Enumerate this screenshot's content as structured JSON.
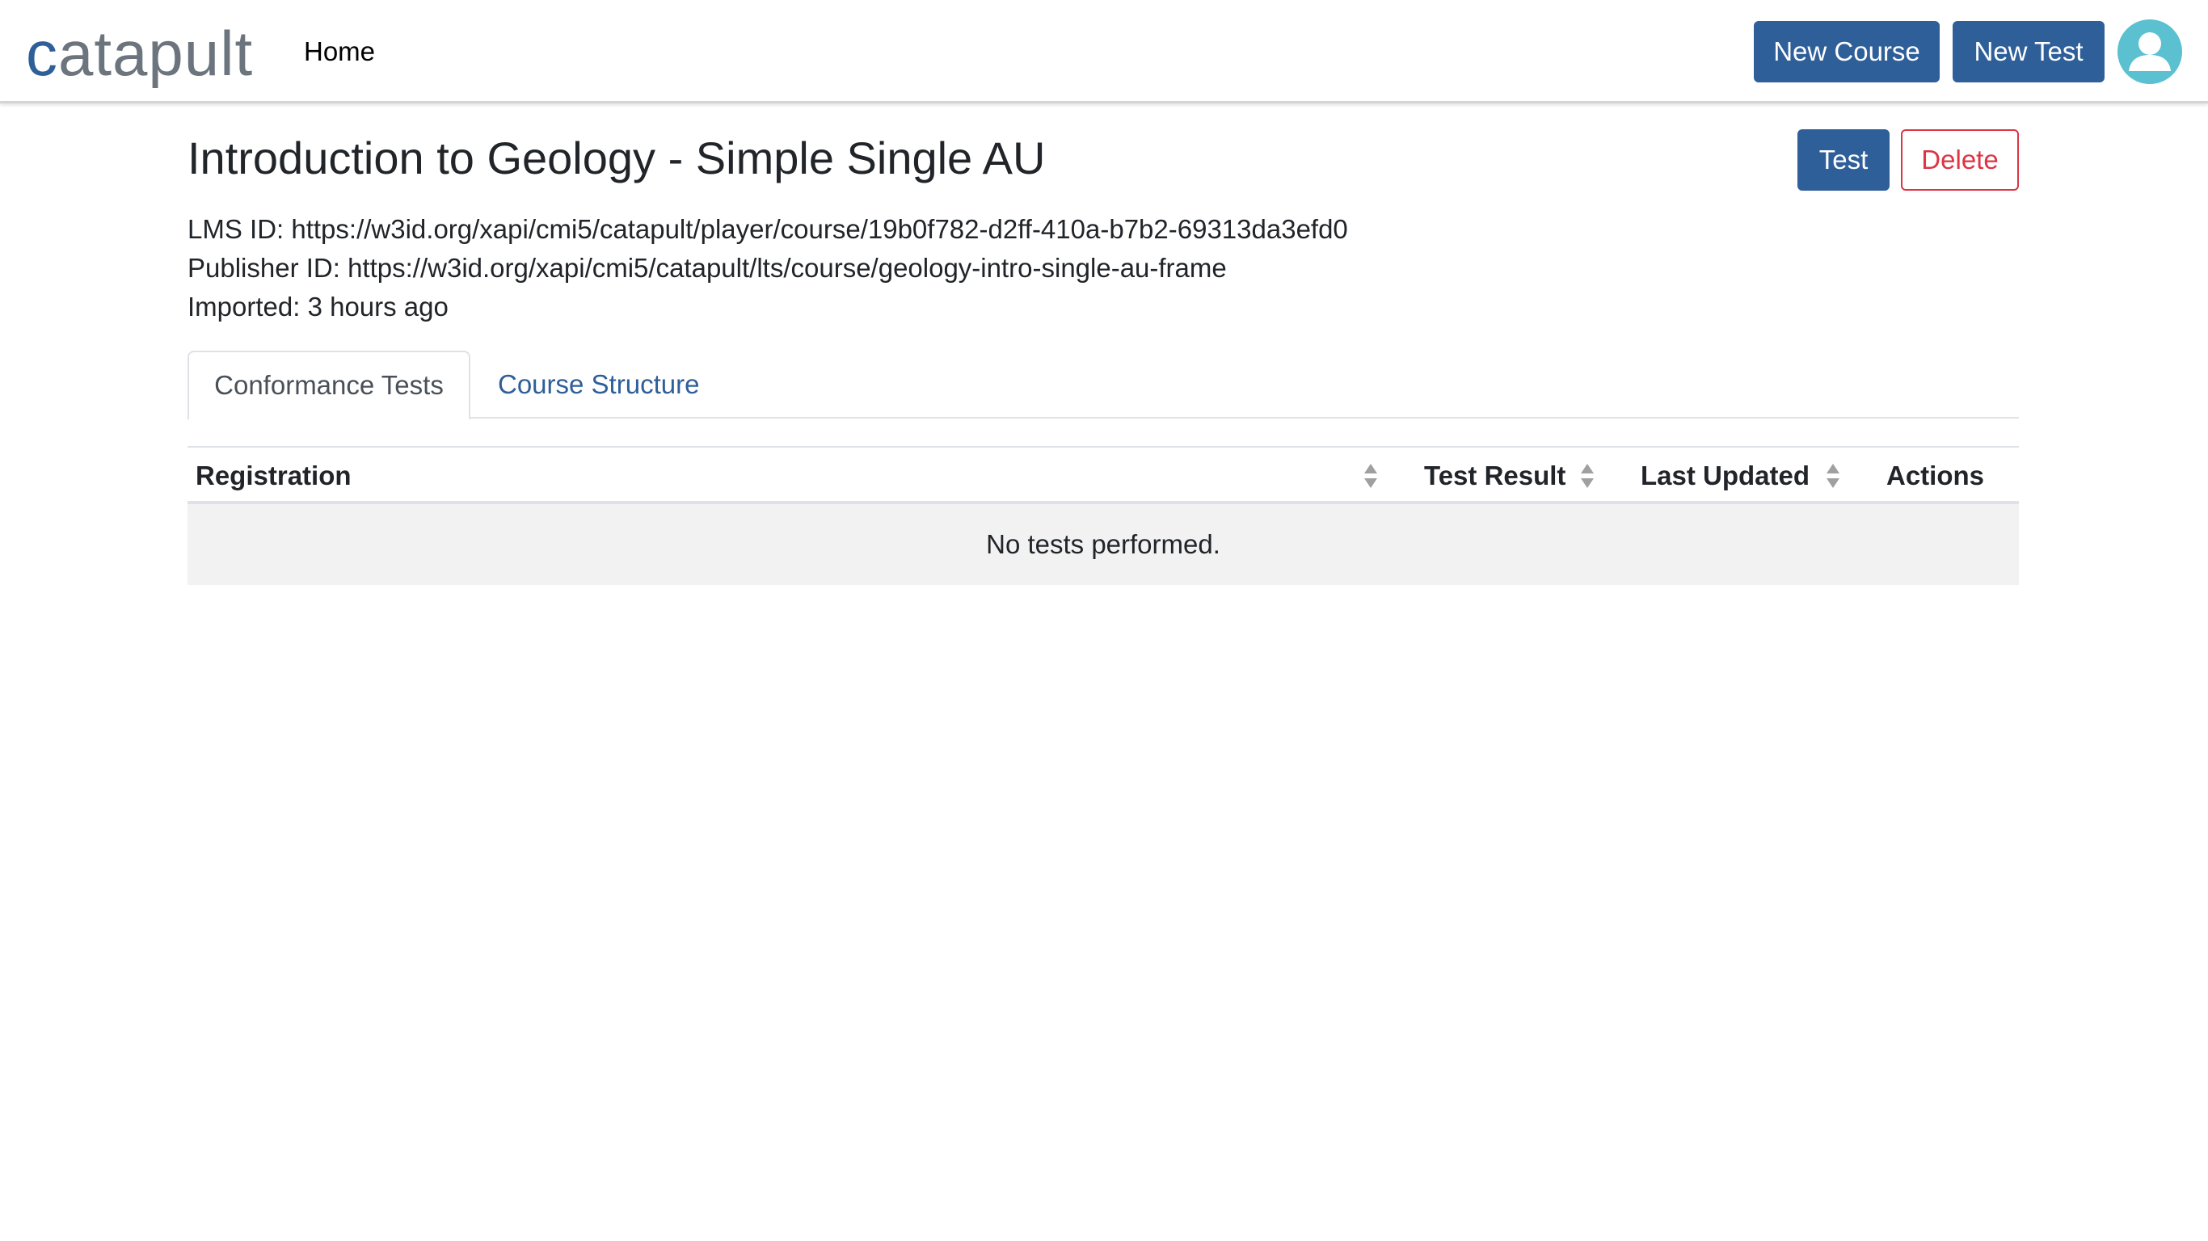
{
  "brand": {
    "prefix": "c",
    "rest": "atapult"
  },
  "nav": {
    "home_label": "Home"
  },
  "header_actions": {
    "new_course_label": "New Course",
    "new_test_label": "New Test"
  },
  "course": {
    "title": "Introduction to Geology - Simple Single AU",
    "lms_id": "LMS ID: https://w3id.org/xapi/cmi5/catapult/player/course/19b0f782-d2ff-410a-b7b2-69313da3efd0",
    "publisher_id": "Publisher ID: https://w3id.org/xapi/cmi5/catapult/lts/course/geology-intro-single-au-frame",
    "imported": "Imported: 3 hours ago",
    "test_label": "Test",
    "delete_label": "Delete"
  },
  "tabs": [
    {
      "label": "Conformance Tests",
      "active": true
    },
    {
      "label": "Course Structure",
      "active": false
    }
  ],
  "table": {
    "columns": [
      "Registration",
      "Test Result",
      "Last Updated",
      "Actions"
    ],
    "empty_message": "No tests performed."
  },
  "icons": {
    "sort": "sort-icon",
    "avatar": "user-avatar-icon"
  },
  "colors": {
    "primary": "#2f5f99",
    "danger": "#dc3545",
    "avatar": "#5bc0d0",
    "brand_text": "#6c757d"
  }
}
